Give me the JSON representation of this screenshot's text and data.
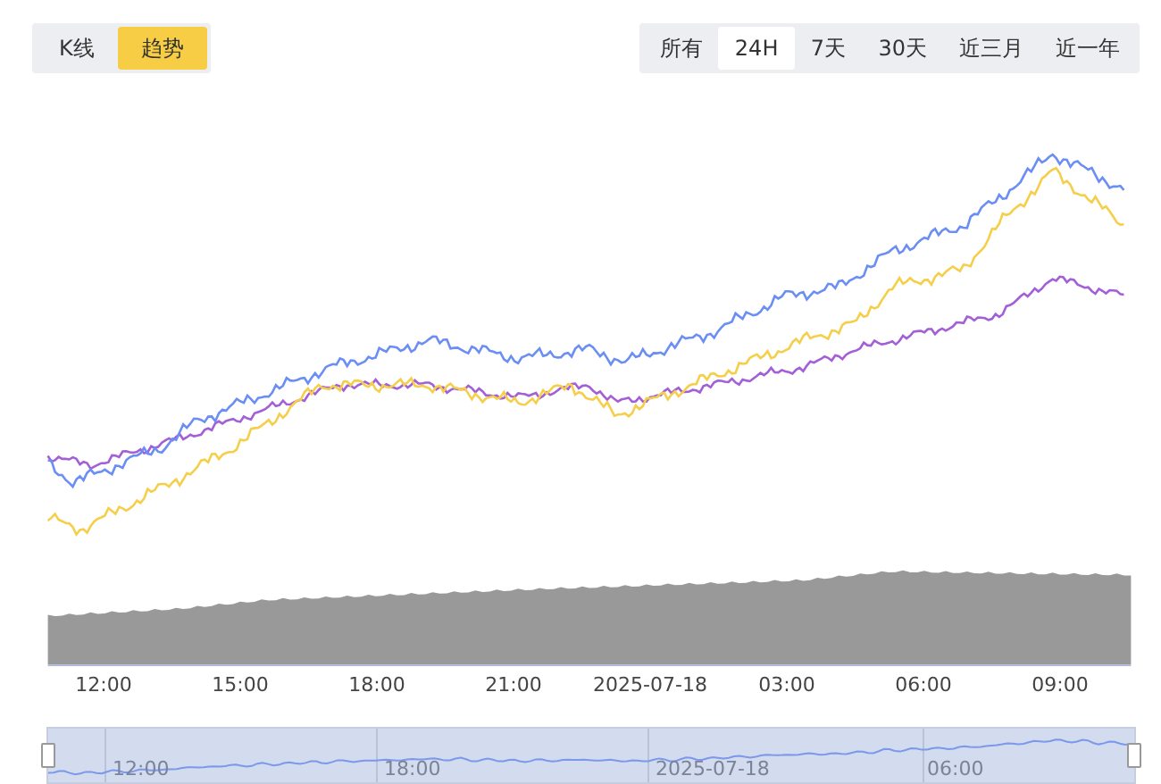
{
  "view_toggle": [
    {
      "label": "K线",
      "selected": false
    },
    {
      "label": "趋势",
      "selected": true
    }
  ],
  "ranges": [
    {
      "label": "所有",
      "selected": false
    },
    {
      "label": "24H",
      "selected": true
    },
    {
      "label": "7天",
      "selected": false
    },
    {
      "label": "30天",
      "selected": false
    },
    {
      "label": "近三月",
      "selected": false
    },
    {
      "label": "近一年",
      "selected": false
    }
  ],
  "chart": {
    "x_axis_labels": [
      "12:00",
      "15:00",
      "18:00",
      "21:00",
      "2025-07-18",
      "03:00",
      "06:00",
      "09:00"
    ]
  },
  "zoom_slider": {
    "level": 1,
    "labels": [
      "12:00",
      "18:00",
      "2025-07-18",
      "06:00"
    ]
  }
}
